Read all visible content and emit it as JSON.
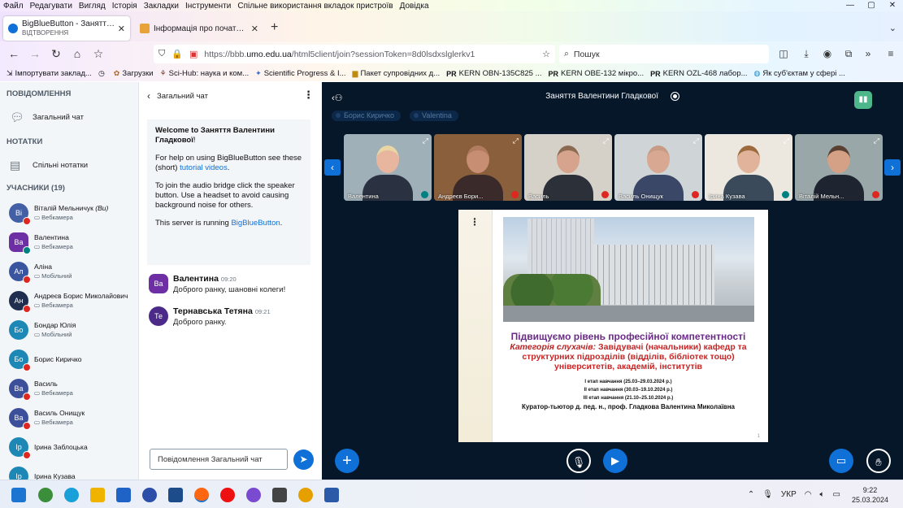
{
  "menubar": {
    "items": [
      "Файл",
      "Редагувати",
      "Вигляд",
      "Історія",
      "Закладки",
      "Інструменти",
      "Спільне використання вкладок пристроїв",
      "Довідка"
    ]
  },
  "tabs": [
    {
      "title": "BigBlueButton - Заняття Вален",
      "subtitle": "ВІДТВОРЕННЯ",
      "active": true
    },
    {
      "title": "Інформація про початок нав",
      "active": false
    }
  ],
  "nav": {
    "url_prefix": "https://bbb.",
    "url_domain": "umo.edu.ua",
    "url_rest": "/html5client/join?sessionToken=8d0lsdxslglerkv1",
    "search_placeholder": "Пошук"
  },
  "bookmarks": [
    {
      "label": "Імпортувати заклад...",
      "icon": "import-icon"
    },
    {
      "label": "",
      "icon": "clock-icon"
    },
    {
      "label": "Загрузки",
      "icon": "gear-icon"
    },
    {
      "label": "Sci-Hub: наука и ком...",
      "icon": "scihub-icon"
    },
    {
      "label": "Scientific Progress & I...",
      "icon": "star-icon"
    },
    {
      "label": "Пакет супровідних д...",
      "icon": "doc-icon"
    },
    {
      "label": "KERN OBN-135C825 ...",
      "icon": "pr-icon"
    },
    {
      "label": "KERN OBE-132 мікро...",
      "icon": "pr-icon"
    },
    {
      "label": "KERN OZL-468 лабор...",
      "icon": "pr-icon"
    },
    {
      "label": "Як суб'єктам у сфері ...",
      "icon": "globe-icon"
    }
  ],
  "sidebar": {
    "messages_heading": "ПОВІДОМЛЕННЯ",
    "public_chat": "Загальний чат",
    "notes_heading": "НОТАТКИ",
    "shared_notes": "Спільні нотатки",
    "participants_heading": "УЧАСНИКИ (19)",
    "users": [
      {
        "initials": "Ві",
        "name": "Віталій Мельничук",
        "you": "(Ви)",
        "sub": "Вебкамера",
        "color": "#4360a6",
        "round": true,
        "audio": "muted"
      },
      {
        "initials": "Ва",
        "name": "Валентина",
        "you": "",
        "sub": "Вебкамера",
        "color": "#6d2fa3",
        "round": false,
        "audio": "on"
      },
      {
        "initials": "Ал",
        "name": "Аліна",
        "you": "",
        "sub": "Мобільний",
        "color": "#3a55a0",
        "round": true,
        "audio": "muted"
      },
      {
        "initials": "Ан",
        "name": "Андреєв Борис Миколайович",
        "you": "",
        "sub": "Вебкамера",
        "color": "#1f2d4f",
        "round": true,
        "audio": "muted"
      },
      {
        "initials": "Бо",
        "name": "Бондар Юлія",
        "you": "",
        "sub": "Мобільний",
        "color": "#1d87b5",
        "round": true,
        "audio": "none"
      },
      {
        "initials": "Бо",
        "name": "Борис Киричко",
        "you": "",
        "sub": "",
        "color": "#1d87b5",
        "round": true,
        "audio": "muted"
      },
      {
        "initials": "Ва",
        "name": "Василь",
        "you": "",
        "sub": "Вебкамера",
        "color": "#3c4f9a",
        "round": true,
        "audio": "muted"
      },
      {
        "initials": "Ва",
        "name": "Василь Онищук",
        "you": "",
        "sub": "Вебкамера",
        "color": "#3c4f9a",
        "round": true,
        "audio": "muted"
      },
      {
        "initials": "Ір",
        "name": "Ірина Заблоцька",
        "you": "",
        "sub": "",
        "color": "#1d87b5",
        "round": true,
        "audio": "muted"
      },
      {
        "initials": "Ір",
        "name": "Ірина Кузава",
        "you": "",
        "sub": "",
        "color": "#1d87b5",
        "round": true,
        "audio": "muted"
      }
    ]
  },
  "chat": {
    "title": "Загальний чат",
    "welcome_prefix": "Welcome to ",
    "welcome_name": "Заняття Валентини Гладкової",
    "welcome_suffix": "!",
    "help_prefix": "For help on using BigBlueButton see these (short) ",
    "help_link": "tutorial videos",
    "help_suffix": ".",
    "audio_text": "To join the audio bridge click the speaker button. Use a headset to avoid causing background noise for others.",
    "server_prefix": "This server is running ",
    "server_link": "BigBlueButton",
    "server_suffix": ".",
    "messages": [
      {
        "initials": "Ва",
        "name": "Валентина",
        "time": "09:20",
        "text": "Доброго ранку, шановні колеги!",
        "color": "#6d2fa3",
        "round": false
      },
      {
        "initials": "Те",
        "name": "Тернавська Тетяна",
        "time": "09:21",
        "text": "Доброго ранку.",
        "color": "#4b2a8a",
        "round": true
      }
    ],
    "input_placeholder": "Повідомлення Загальний чат"
  },
  "meeting": {
    "title": "Заняття Валентини Гладкової",
    "talkers": [
      "Борис Киричко",
      "Valentina"
    ]
  },
  "videos": [
    {
      "name": "Валентина",
      "mic": "on",
      "bg": "#9fb0b8",
      "skin": "#e8b59e",
      "cloth": "#2a3140",
      "hair": "#e9d6a3"
    },
    {
      "name": "Андреєв Бори...",
      "mic": "muted",
      "bg": "#8a5f3c",
      "skin": "#c88e74",
      "cloth": "#3a2a2a",
      "hair": "#b27c60"
    },
    {
      "name": "Василь",
      "mic": "muted",
      "bg": "#d6d1c8",
      "skin": "#d6a48c",
      "cloth": "#2c3038",
      "hair": "#8a6a50"
    },
    {
      "name": "Василь Онищук",
      "mic": "muted",
      "bg": "#cfd4d6",
      "skin": "#d8a893",
      "cloth": "#3b4766",
      "hair": "#c79b85"
    },
    {
      "name": "Ірина Кузава",
      "mic": "on",
      "bg": "#ece8e0",
      "skin": "#e0b39a",
      "cloth": "#3a4a5a",
      "hair": "#9c6a3c"
    },
    {
      "name": "Віталій Мельн...",
      "mic": "muted",
      "bg": "#9aa7a8",
      "skin": "#d4a186",
      "cloth": "#1f2530",
      "hair": "#5a4030"
    }
  ],
  "slide": {
    "headline": "Підвищуємо рівень професійної компетентності",
    "category_label": "Категорія слухачів:",
    "category_text": "Завідувачі (начальники) кафедр та структурних підрозділів (відділів, бібліотек тощо) університетів, академій, інститутів",
    "stage1": "I етап навчання (25.03–29.03.2024 р.)",
    "stage2": "II етап навчання (30.03–19.10.2024 р.)",
    "stage3": "III етап навчання (21.10–25.10.2024 р.)",
    "curator": "Куратор-тьютор   д. пед. н., проф.  Гладкова Валентина Миколаївна",
    "page": "1"
  },
  "taskbar": {
    "lang": "УКР",
    "time": "9:22",
    "date": "25.03.2024"
  },
  "colors": {
    "bbb_blue": "#0f70d7",
    "main_bg": "#06172a",
    "mute_red": "#df2721",
    "audio_teal": "#008081"
  }
}
